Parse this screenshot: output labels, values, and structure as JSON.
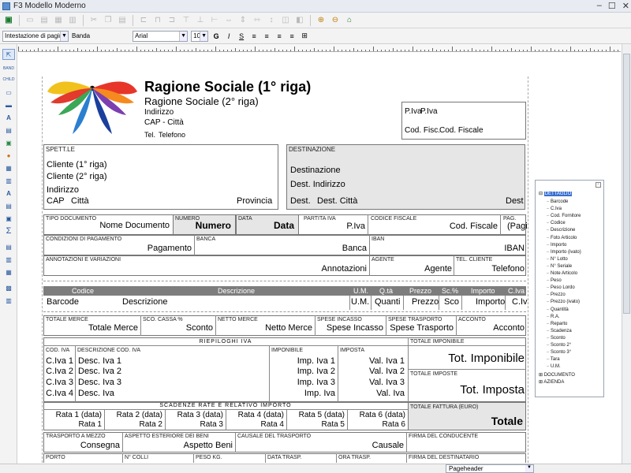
{
  "window": {
    "title": "F3 Modello Moderno"
  },
  "format": {
    "band_type": "Intestazione di pagina",
    "band_label": "Banda",
    "font": "Arial",
    "size": "10",
    "bold": "G",
    "italic": "I",
    "underline": "S"
  },
  "status": {
    "band": "Pageheader"
  },
  "header": {
    "ragione1": "Ragione Sociale (1° riga)",
    "ragione2": "Ragione Sociale (2° riga)",
    "indirizzo": "Indirizzo",
    "cap_citta": "CAP - Città",
    "tel_label": "Tel.",
    "telefono": "Telefono",
    "piva_label": "P.Iva",
    "piva": "P.Iva",
    "codfisc_label": "Cod. Fisc.",
    "codfisc": "Cod. Fiscale"
  },
  "spett": {
    "title": "SPETT.LE",
    "cliente1": "Cliente (1° riga)",
    "cliente2": "Cliente (2° riga)",
    "indirizzo": "Indirizzo",
    "cap": "CAP",
    "citta": "Città",
    "provincia": "Provincia"
  },
  "dest": {
    "title": "DESTINAZIONE",
    "destinazione": "Destinazione",
    "indirizzo": "Dest. Indirizzo",
    "dest1": "Dest.",
    "citta": "Dest. Città",
    "dest2": "Dest"
  },
  "doc": {
    "tipo_label": "TIPO DOCUMENTO",
    "tipo": "Nome Documento",
    "numero_label": "NUMERO",
    "numero": "Numero",
    "data_label": "DATA",
    "data": "Data",
    "piva_label": "PARTITA IVA",
    "piva": "P.Iva",
    "cf_label": "CODICE FISCALE",
    "cf": "Cod. Fiscale",
    "pag_label": "PAG.",
    "pag": "(Pagi",
    "cond_label": "CONDIZIONI DI PAGAMENTO",
    "cond": "Pagamento",
    "banca_label": "BANCA",
    "banca": "Banca",
    "iban_label": "IBAN",
    "iban": "IBAN",
    "annot_label": "ANNOTAZIONI E VARIAZIONI",
    "annot": "Annotazioni",
    "agente_label": "AGENTE",
    "agente": "Agente",
    "telcli_label": "TEL. CLIENTE",
    "telcli": "Telefono"
  },
  "detail": {
    "headers": [
      "Codice",
      "Descrizione",
      "U.M.",
      "Q.tà",
      "Prezzo",
      "Sc.%",
      "Importo",
      "C.Iva"
    ],
    "values": [
      "Barcode",
      "Descrizione",
      "U.M.",
      "Quanti",
      "Prezzo",
      "Sco",
      "Importo",
      "C.Iv"
    ]
  },
  "totals": {
    "merce_label": "TOTALE MERCE",
    "merce": "Totale Merce",
    "sconto_label": "SCO. CASSA %",
    "sconto": "Sconto",
    "netto_label": "NETTO MERCE",
    "netto": "Netto Merce",
    "incasso_label": "SPESE INCASSO",
    "incasso": "Spese Incasso",
    "trasporto_label": "SPESE TRASPORTO",
    "trasporto": "Spese Trasporto",
    "acconto_label": "ACCONTO",
    "acconto": "Acconto"
  },
  "iva": {
    "title": "RIEPILOGHI IVA",
    "cod_label": "COD. IVA",
    "desc_label": "DESCRIZIONE COD. IVA",
    "imp_label": "IMPONIBILE",
    "imposta_label": "IMPOSTA",
    "rows": [
      {
        "cod": "C.Iva 1",
        "desc": "Desc. Iva 1",
        "imp": "Imp. Iva 1",
        "val": "Val. Iva 1"
      },
      {
        "cod": "C.Iva 2",
        "desc": "Desc. Iva 2",
        "imp": "Imp. Iva 2",
        "val": "Val. Iva 2"
      },
      {
        "cod": "C.Iva 3",
        "desc": "Desc. Iva 3",
        "imp": "Imp. Iva 3",
        "val": "Val. Iva 3"
      },
      {
        "cod": "C.Iva 4",
        "desc": "Desc. Iva",
        "imp": "Imp. Iva",
        "val": "Val. Iva"
      }
    ],
    "tot_imp_label": "TOTALE IMPONIBILE",
    "tot_imp": "Tot. Imponibile",
    "tot_imposta_label": "TOTALE IMPOSTE",
    "tot_imposta": "Tot. Imposta"
  },
  "scadenze": {
    "title": "SCADENZE RATE E RELATIVO IMPORTO",
    "rate": [
      {
        "d": "Rata 1 (data)",
        "v": "Rata 1"
      },
      {
        "d": "Rata 2 (data)",
        "v": "Rata 2"
      },
      {
        "d": "Rata 3 (data)",
        "v": "Rata 3"
      },
      {
        "d": "Rata 4 (data)",
        "v": "Rata 4"
      },
      {
        "d": "Rata 5 (data)",
        "v": "Rata 5"
      },
      {
        "d": "Rata 6 (data)",
        "v": "Rata 6"
      }
    ],
    "totale_label": "TOTALE FATTURA (EURO)",
    "totale": "Totale"
  },
  "footer": {
    "trasporto_label": "TRASPORTO A MEZZO",
    "trasporto": "Consegna",
    "aspetto_label": "ASPETTO ESTERIORE DEI BENI",
    "aspetto": "Aspetto Beni",
    "causale_label": "CAUSALE DEL TRASPORTO",
    "causale": "Causale",
    "firma_cond_label": "FIRMA DEL CONDUCENTE",
    "porto_label": "PORTO",
    "colli_label": "N° COLLI",
    "peso_label": "PESO KG.",
    "data_trasp_label": "DATA TRASP.",
    "ora_trasp_label": "ORA TRASP.",
    "firma_dest_label": "FIRMA DEL DESTINATARIO"
  },
  "tree": {
    "root": "DETTAGLIO",
    "items": [
      "Barcode",
      "C.Iva",
      "Cod. Fornitore",
      "Codice",
      "Descrizione",
      "Foto Articolo",
      "Importo",
      "Importo (ivato)",
      "N° Lotto",
      "N° Seriale",
      "Note Articolo",
      "Peso",
      "Peso Lordo",
      "Prezzo",
      "Prezzo (ivato)",
      "Quantità",
      "R.A.",
      "Reparto",
      "Scadenza",
      "Sconto",
      "Sconto 2°",
      "Sconto 3°",
      "Tara",
      "U.M."
    ],
    "others": [
      "DOCUMENTO",
      "AZIENDA"
    ]
  }
}
